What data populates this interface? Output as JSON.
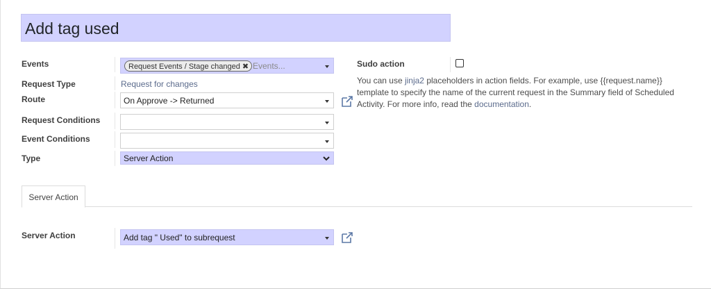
{
  "record": {
    "title": "Add tag used"
  },
  "fields": {
    "events": {
      "label": "Events",
      "tag": "Request Events / Stage changed",
      "tag_remove": "✖",
      "placeholder": "Events..."
    },
    "request_type": {
      "label": "Request Type",
      "value": "Request for changes"
    },
    "route": {
      "label": "Route",
      "value": "On Approve -> Returned"
    },
    "request_conditions": {
      "label": "Request Conditions",
      "value": ""
    },
    "event_conditions": {
      "label": "Event Conditions",
      "value": ""
    },
    "type": {
      "label": "Type",
      "value": "Server Action"
    }
  },
  "sudo": {
    "label": "Sudo action",
    "checked": false,
    "help_1": "You can use ",
    "help_link_jinja": "jinja2",
    "help_2": " placeholders in action fields. For example, use {{request.name}} template to specify the name of the current request in the Summary field of Scheduled Activity. For more info, read the ",
    "help_link_docs": "documentation",
    "help_3": "."
  },
  "tabs": [
    {
      "label": "Server Action",
      "active": true
    }
  ],
  "server_action": {
    "label": "Server Action",
    "value": "Add tag \" Used\" to subrequest"
  },
  "icons": {
    "external_link": "external-link-icon",
    "dropdown": "caret-down-icon",
    "select_chevron": "chevron-down-icon"
  },
  "colors": {
    "required_bg": "#d2d2ff",
    "link": "#5b6b8c"
  }
}
